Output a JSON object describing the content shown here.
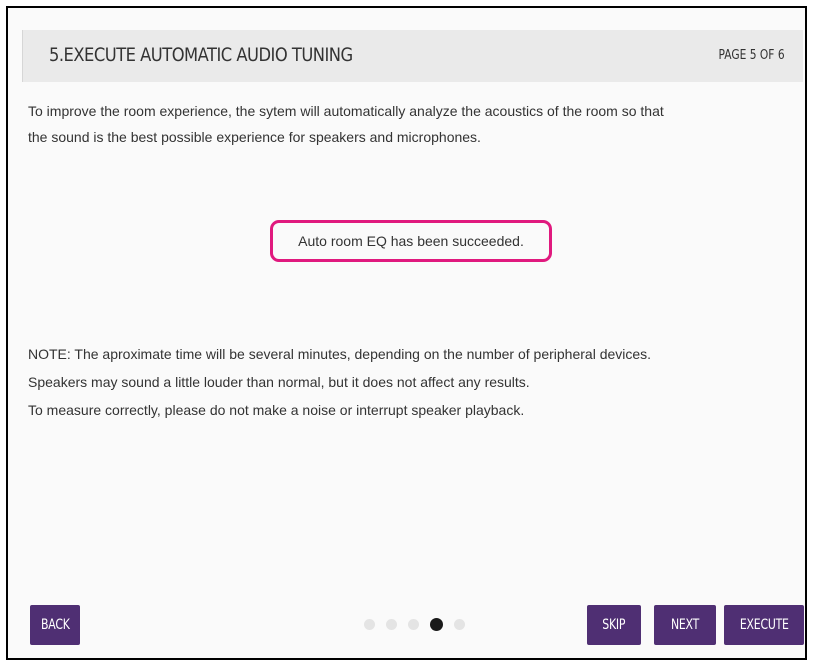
{
  "header": {
    "title": "5.EXECUTE AUTOMATIC AUDIO TUNING",
    "page_indicator": "PAGE 5 OF 6"
  },
  "intro": {
    "line1": "To improve the room experience, the sytem will automatically analyze the acoustics of the room so that",
    "line2": "the sound is the best possible experience for speakers and microphones."
  },
  "status": {
    "message": "Auto room EQ has been succeeded.",
    "highlight_color": "#e0197e"
  },
  "notes": {
    "line1": "NOTE: The aproximate time will be several minutes, depending on the number of peripheral devices.",
    "line2": "Speakers may sound a little louder than normal, but it does not affect any results.",
    "line3": "To measure correctly, please do not make a noise or interrupt speaker playback."
  },
  "pagination": {
    "total": 5,
    "active_index": 3
  },
  "buttons": {
    "back": "BACK",
    "skip": "SKIP",
    "next": "NEXT",
    "execute": "EXECUTE",
    "color": "#4f2f73"
  }
}
